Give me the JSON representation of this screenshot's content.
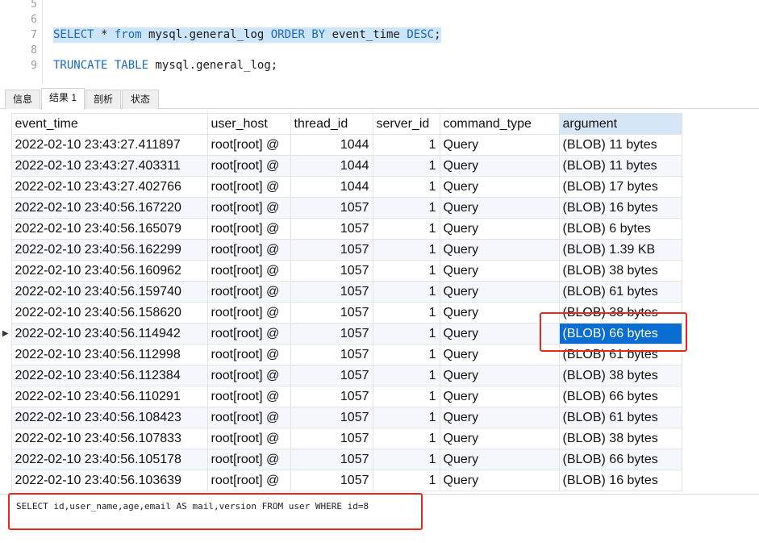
{
  "editor": {
    "lines": [
      {
        "num": "5",
        "tokens": []
      },
      {
        "num": "6",
        "tokens": []
      },
      {
        "num": "7",
        "selected": true,
        "tokens": [
          {
            "t": "SELECT",
            "kw": true
          },
          {
            "t": " * "
          },
          {
            "t": "from",
            "kw": true
          },
          {
            "t": " mysql.general_log "
          },
          {
            "t": "ORDER BY",
            "kw": true
          },
          {
            "t": " event_time "
          },
          {
            "t": "DESC",
            "kw": true
          },
          {
            "t": ";"
          }
        ]
      },
      {
        "num": "8",
        "tokens": []
      },
      {
        "num": "9",
        "tokens": [
          {
            "t": "TRUNCATE",
            "kw": true
          },
          {
            "t": " "
          },
          {
            "t": "TABLE",
            "kw": true
          },
          {
            "t": " mysql.general_log;"
          }
        ]
      }
    ],
    "keyword_color": "#1a67c9",
    "selection_color": "#cde5fb"
  },
  "tabs": [
    {
      "label": "信息",
      "active": false
    },
    {
      "label": "结果 1",
      "active": true
    },
    {
      "label": "剖析",
      "active": false
    },
    {
      "label": "状态",
      "active": false
    }
  ],
  "grid": {
    "columns": [
      {
        "label": "event_time",
        "sorted": false
      },
      {
        "label": "user_host",
        "sorted": false
      },
      {
        "label": "thread_id",
        "sorted": false
      },
      {
        "label": "server_id",
        "sorted": false
      },
      {
        "label": "command_type",
        "sorted": false
      },
      {
        "label": "argument",
        "sorted": true
      }
    ],
    "current_row_marker": "▶",
    "selected_row_index": 9,
    "rows": [
      [
        "2022-02-10 23:43:27.411897",
        "root[root] @",
        "1044",
        "1",
        "Query",
        "(BLOB) 11 bytes"
      ],
      [
        "2022-02-10 23:43:27.403311",
        "root[root] @",
        "1044",
        "1",
        "Query",
        "(BLOB) 11 bytes"
      ],
      [
        "2022-02-10 23:43:27.402766",
        "root[root] @",
        "1044",
        "1",
        "Query",
        "(BLOB) 17 bytes"
      ],
      [
        "2022-02-10 23:40:56.167220",
        "root[root] @",
        "1057",
        "1",
        "Query",
        "(BLOB) 16 bytes"
      ],
      [
        "2022-02-10 23:40:56.165079",
        "root[root] @",
        "1057",
        "1",
        "Query",
        "(BLOB) 6 bytes"
      ],
      [
        "2022-02-10 23:40:56.162299",
        "root[root] @",
        "1057",
        "1",
        "Query",
        "(BLOB) 1.39 KB"
      ],
      [
        "2022-02-10 23:40:56.160962",
        "root[root] @",
        "1057",
        "1",
        "Query",
        "(BLOB) 38 bytes"
      ],
      [
        "2022-02-10 23:40:56.159740",
        "root[root] @",
        "1057",
        "1",
        "Query",
        "(BLOB) 61 bytes"
      ],
      [
        "2022-02-10 23:40:56.158620",
        "root[root] @",
        "1057",
        "1",
        "Query",
        "(BLOB) 38 bytes"
      ],
      [
        "2022-02-10 23:40:56.114942",
        "root[root] @",
        "1057",
        "1",
        "Query",
        "(BLOB) 66 bytes"
      ],
      [
        "2022-02-10 23:40:56.112998",
        "root[root] @",
        "1057",
        "1",
        "Query",
        "(BLOB) 61 bytes"
      ],
      [
        "2022-02-10 23:40:56.112384",
        "root[root] @",
        "1057",
        "1",
        "Query",
        "(BLOB) 38 bytes"
      ],
      [
        "2022-02-10 23:40:56.110291",
        "root[root] @",
        "1057",
        "1",
        "Query",
        "(BLOB) 66 bytes"
      ],
      [
        "2022-02-10 23:40:56.108423",
        "root[root] @",
        "1057",
        "1",
        "Query",
        "(BLOB) 61 bytes"
      ],
      [
        "2022-02-10 23:40:56.107833",
        "root[root] @",
        "1057",
        "1",
        "Query",
        "(BLOB) 38 bytes"
      ],
      [
        "2022-02-10 23:40:56.105178",
        "root[root] @",
        "1057",
        "1",
        "Query",
        "(BLOB) 66 bytes"
      ],
      [
        "2022-02-10 23:40:56.103639",
        "root[root] @",
        "1057",
        "1",
        "Query",
        "(BLOB) 16 bytes"
      ]
    ],
    "selection_color": "#0a6dd1"
  },
  "detail": {
    "text": "SELECT id,user_name,age,email AS mail,version FROM user WHERE id=8"
  },
  "annotation_color": "#e8281c"
}
